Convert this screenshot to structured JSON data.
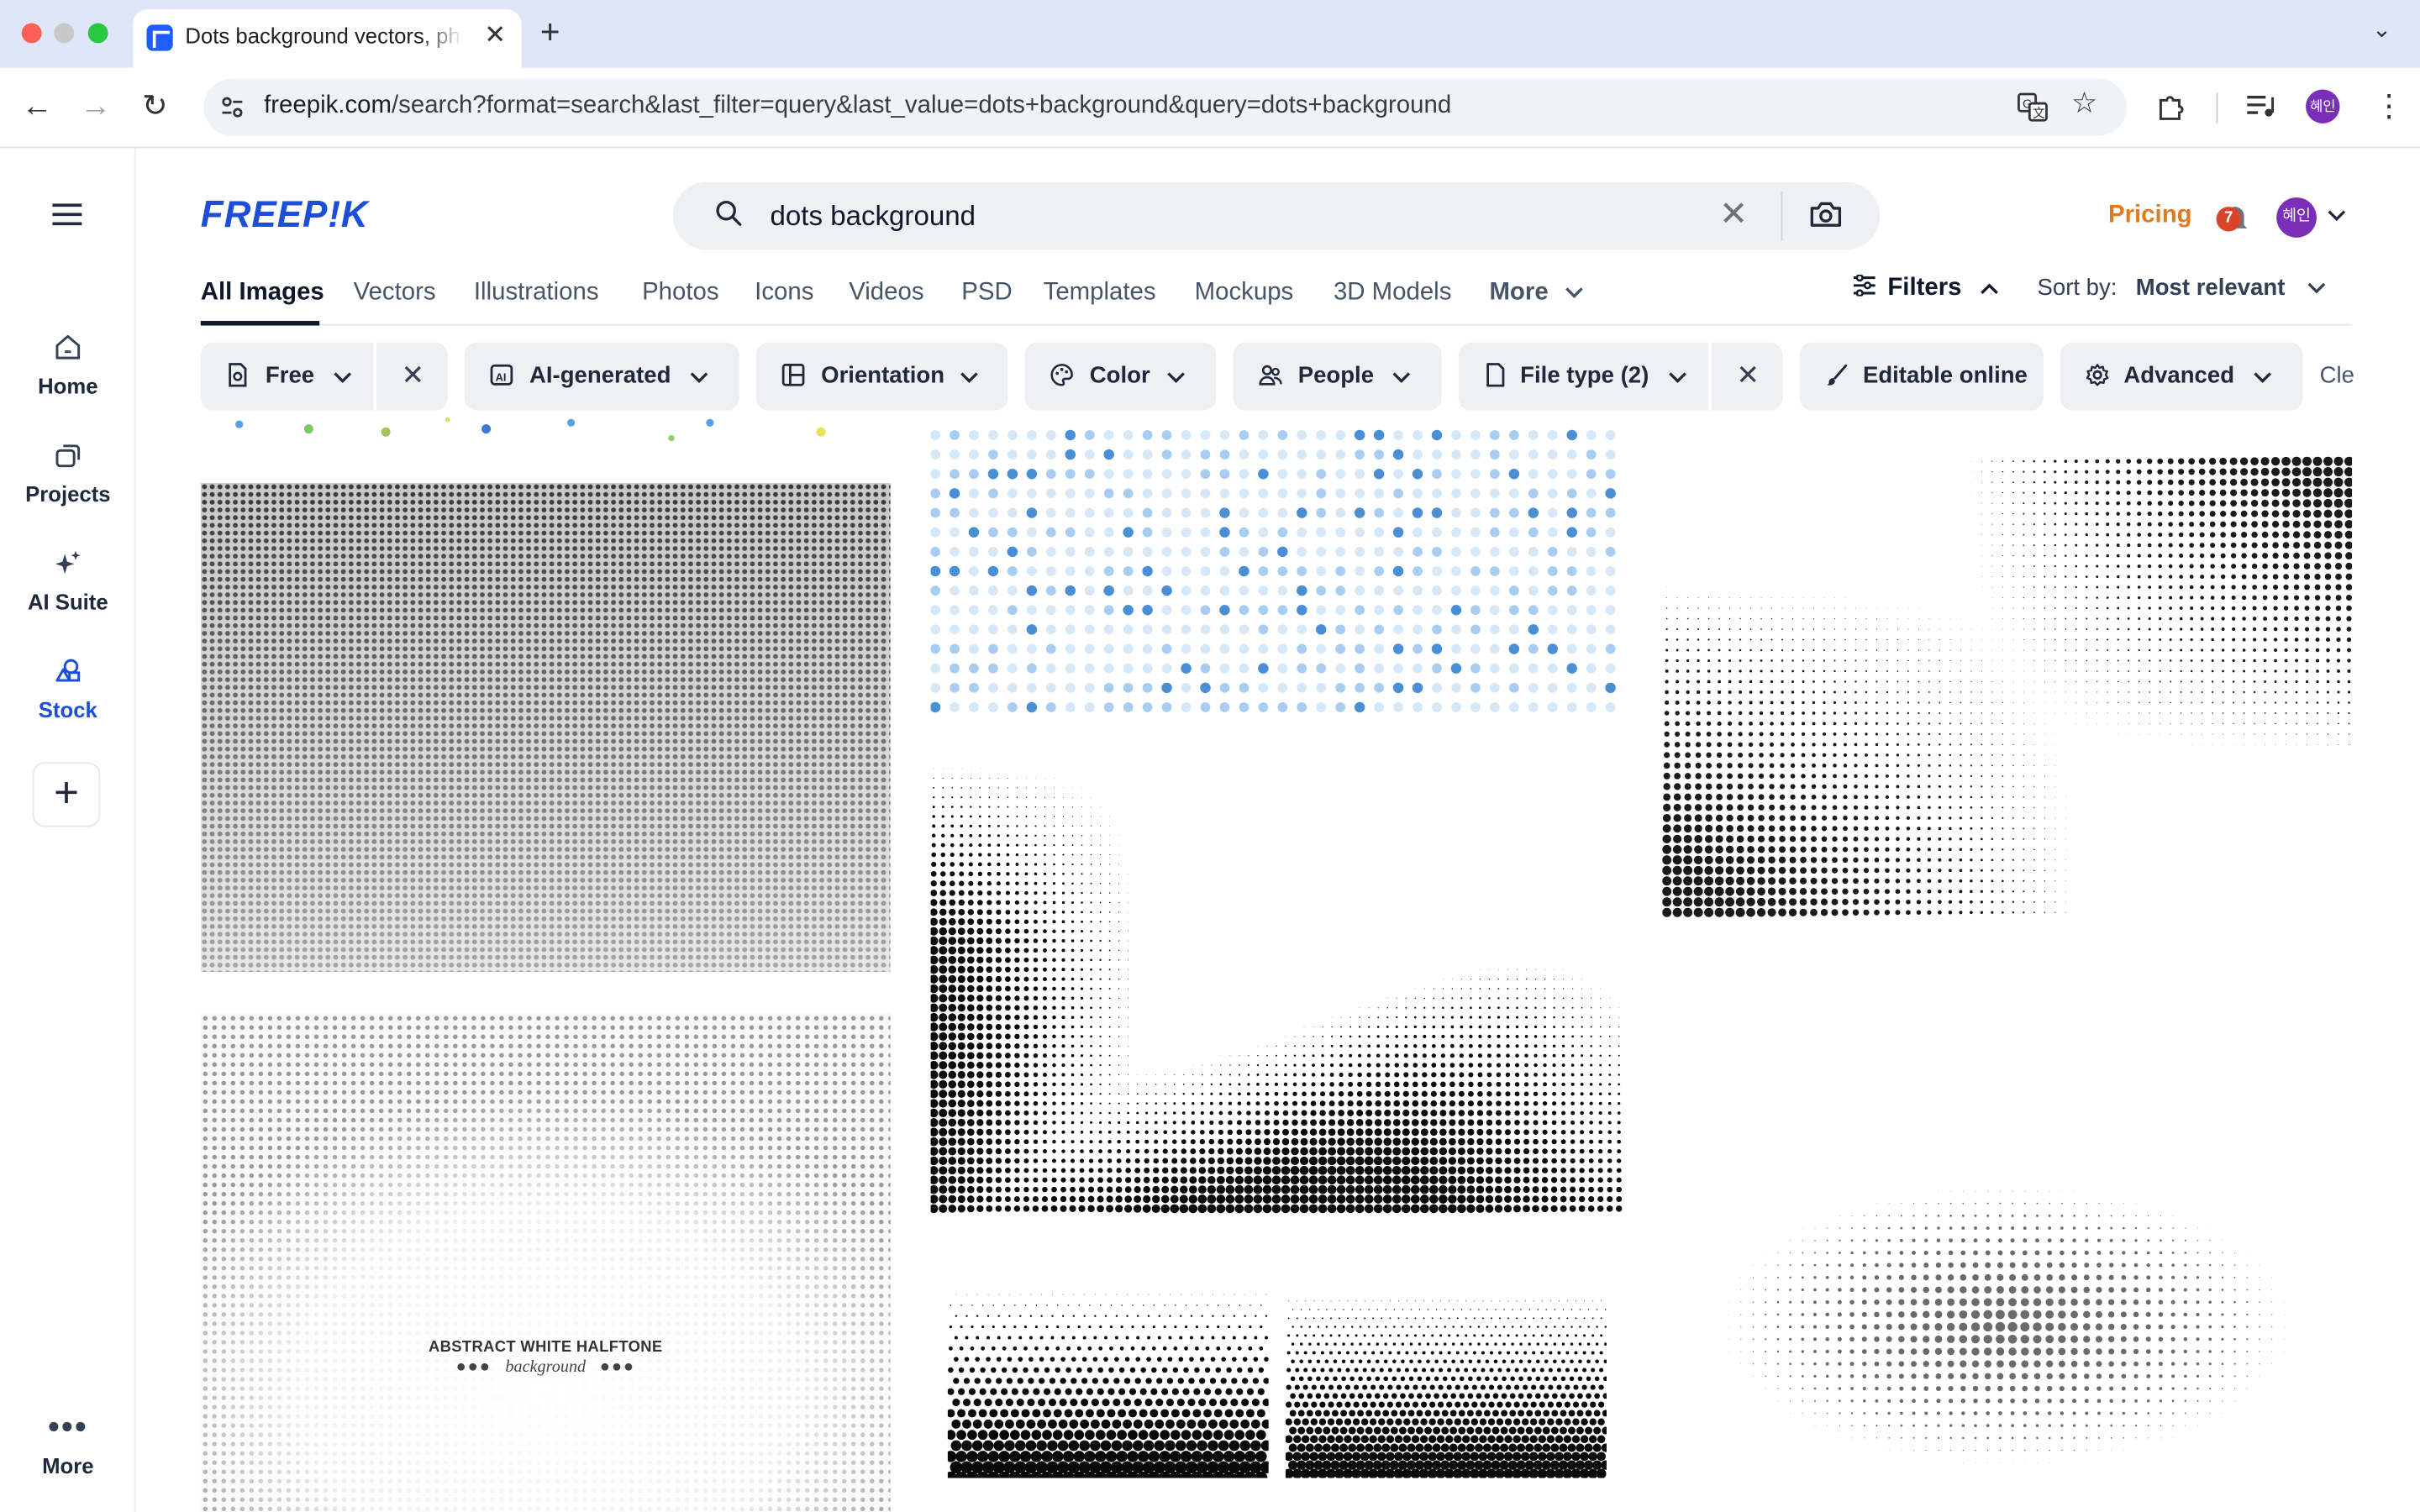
{
  "browser": {
    "tab_title": "Dots background vectors, photos and PSD files",
    "url_host": "freepik.com",
    "url_rest": "/search?format=search&last_filter=query&last_value=dots+background&query=dots+background",
    "profile_initials": "혜인"
  },
  "rail": {
    "items": [
      {
        "label": "Home",
        "icon": "home-icon"
      },
      {
        "label": "Projects",
        "icon": "projects-icon"
      },
      {
        "label": "AI Suite",
        "icon": "sparkles-icon"
      },
      {
        "label": "Stock",
        "icon": "stock-icon"
      }
    ],
    "more_label": "More"
  },
  "header": {
    "logo_text": "FREEP!K",
    "search_value": "dots background",
    "pricing_label": "Pricing",
    "notification_count": "7",
    "avatar_initials": "혜인"
  },
  "categories": {
    "items": [
      "All Images",
      "Vectors",
      "Illustrations",
      "Photos",
      "Icons",
      "Videos",
      "PSD",
      "Templates",
      "Mockups",
      "3D Models",
      "More"
    ],
    "active": "All Images",
    "filters_label": "Filters",
    "sort_label": "Sort by:",
    "sort_value": "Most relevant"
  },
  "chips": {
    "free": "Free",
    "ai_generated": "AI-generated",
    "orientation": "Orientation",
    "color": "Color",
    "people": "People",
    "file_type": "File type (2)",
    "editable_online": "Editable online",
    "advanced": "Advanced",
    "clear": "Cle"
  },
  "results": {
    "halftone_title": "ABSTRACT WHITE HALFTONE",
    "halftone_subtitle": "background"
  },
  "colors": {
    "brand": "#1d4ed8",
    "pricing": "#e07b22",
    "chip_bg": "#eef0f3"
  }
}
